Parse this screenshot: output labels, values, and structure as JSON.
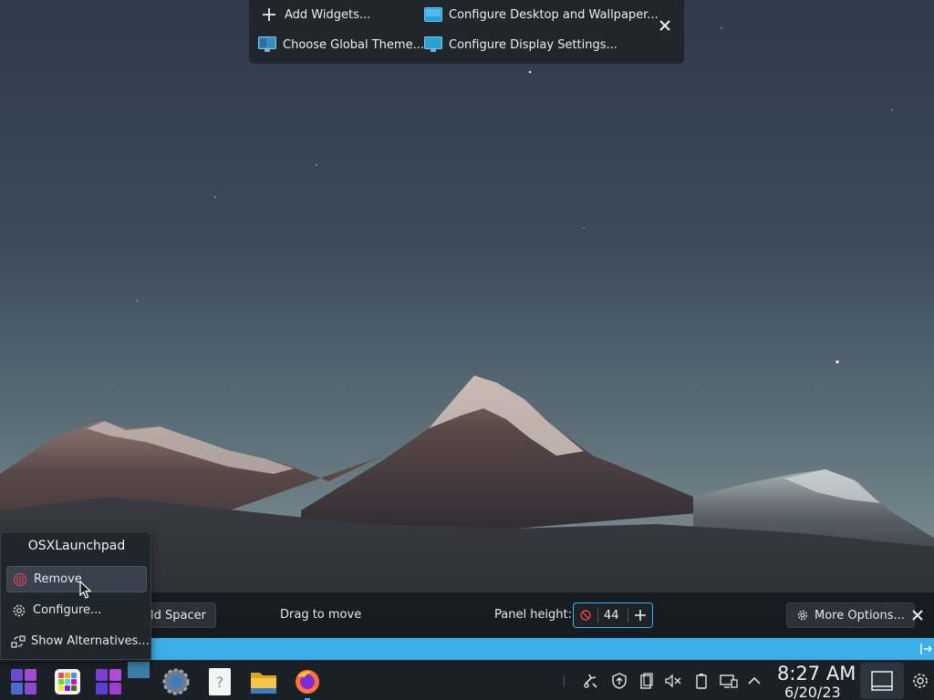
{
  "desktop_toolbar": {
    "add_widgets": "Add Widgets...",
    "configure_desktop": "Configure Desktop and Wallpaper...",
    "choose_theme": "Choose Global Theme...",
    "configure_display": "Configure Display Settings..."
  },
  "edit_bar": {
    "spacer_label": "ld Spacer",
    "drag_label": "Drag to move",
    "panel_height_label": "Panel height:",
    "panel_height_value": "44",
    "more_options": "More Options..."
  },
  "context_menu": {
    "title": "OSXLaunchpad",
    "items": [
      {
        "label": "Remove",
        "icon": "trash-icon"
      },
      {
        "label": "Configure...",
        "icon": "gear-icon"
      },
      {
        "label": "Show Alternatives...",
        "icon": "switch-icon"
      }
    ]
  },
  "taskbar": {
    "apps": [
      "app-launcher",
      "app-grid",
      "launchpad",
      "settings",
      "help",
      "files",
      "firefox"
    ],
    "clock_time": "8:27 AM",
    "clock_date": "6/20/23"
  },
  "colors": {
    "accent": "#3daee9",
    "panel": "#1b2026",
    "menu": "#20262c",
    "remove_red": "#da4453"
  }
}
